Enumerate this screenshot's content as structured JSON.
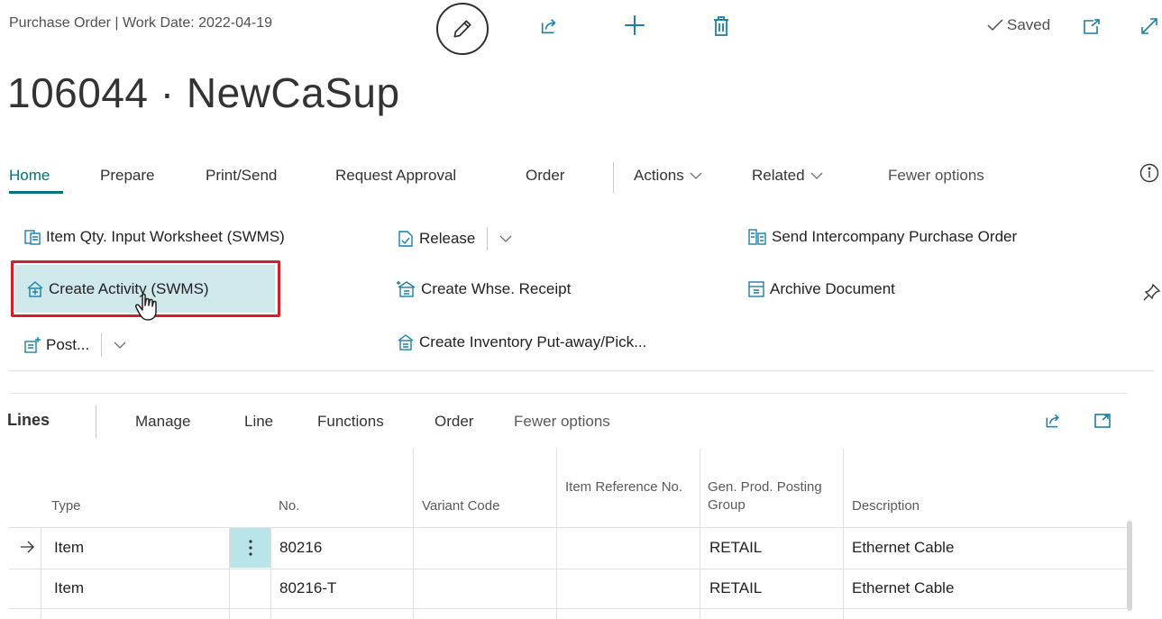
{
  "header": {
    "caption": "Purchase Order | Work Date: 2022-04-19",
    "saved_label": "Saved",
    "title": "106044 · NewCaSup"
  },
  "action_tabs": [
    "Home",
    "Prepare",
    "Print/Send",
    "Request Approval",
    "Order",
    "Actions",
    "Related",
    "Fewer options"
  ],
  "actions": {
    "item_qty_worksheet": "Item Qty. Input Worksheet (SWMS)",
    "create_activity": "Create Activity (SWMS)",
    "post": "Post...",
    "release": "Release",
    "create_whse_receipt": "Create Whse. Receipt",
    "create_inventory_putaway": "Create Inventory Put-away/Pick...",
    "send_intercompany": "Send Intercompany Purchase Order",
    "archive_document": "Archive Document"
  },
  "lines": {
    "title": "Lines",
    "tabs": [
      "Manage",
      "Line",
      "Functions",
      "Order",
      "Fewer options"
    ],
    "columns": {
      "type": "Type",
      "no": "No.",
      "variant_code": "Variant Code",
      "item_reference_no": "Item Reference No.",
      "gen_prod_posting_group": "Gen. Prod. Posting Group",
      "description": "Description"
    },
    "rows": [
      {
        "type": "Item",
        "no": "80216",
        "variant_code": "",
        "item_reference_no": "",
        "gen_prod_posting_group": "RETAIL",
        "description": "Ethernet Cable"
      },
      {
        "type": "Item",
        "no": "80216-T",
        "variant_code": "",
        "item_reference_no": "",
        "gen_prod_posting_group": "RETAIL",
        "description": "Ethernet Cable"
      }
    ]
  },
  "colors": {
    "accent": "#00747e",
    "selection": "#cfe8ea",
    "highlight_border": "#d0202b"
  },
  "icons": [
    "edit-icon",
    "share-icon",
    "plus-icon",
    "trash-icon",
    "check-icon",
    "open-new-window-icon",
    "expand-icon",
    "info-icon",
    "pin-icon",
    "chevron-down-icon",
    "row-arrow-icon",
    "more-dots-icon"
  ]
}
